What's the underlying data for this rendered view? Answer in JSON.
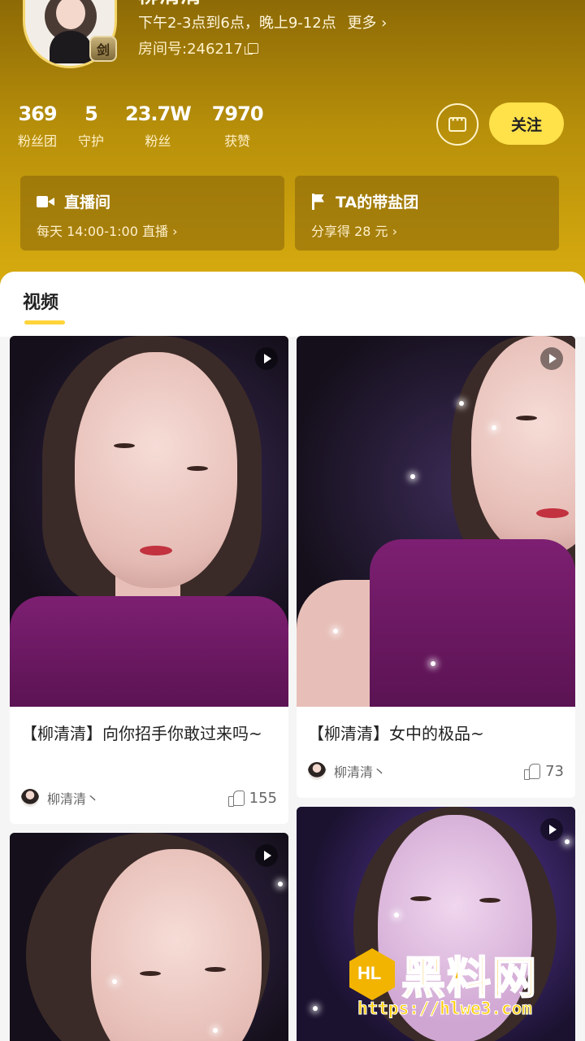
{
  "profile": {
    "name": "柳清清",
    "avatar_badge": "剑",
    "schedule": "下午2-3点到6点，晚上9-12点",
    "schedule_more": "更多 ›",
    "room_label": "房间号:246217"
  },
  "stats": [
    {
      "value": "369",
      "label": "粉丝团"
    },
    {
      "value": "5",
      "label": "守护"
    },
    {
      "value": "23.7W",
      "label": "粉丝"
    },
    {
      "value": "7970",
      "label": "获赞"
    }
  ],
  "actions": {
    "follow_label": "关注",
    "message_icon": "chat-bubble-icon"
  },
  "cards": {
    "live": {
      "title": "直播间",
      "subtitle": "每天 14:00-1:00 直播 ›",
      "icon": "video-camera-icon"
    },
    "team": {
      "title": "TA的带盐团",
      "subtitle": "分享得 28 元 ›",
      "icon": "flag-icon"
    }
  },
  "tabs": {
    "active": "视频"
  },
  "videos": [
    {
      "title": "【柳清清】向你招手你敢过来吗~",
      "author": "柳清清丶",
      "likes": "155"
    },
    {
      "title": "【柳清清】女中的极品~",
      "author": "柳清清丶",
      "likes": "73"
    }
  ],
  "watermark": {
    "logo_text": "HL",
    "name": "黑料网",
    "url": "https://hlwe3.com"
  },
  "colors": {
    "header_gold": "#b8900a",
    "follow_yellow": "#ffe14a",
    "tab_underline": "#ffd43a",
    "dress_purple": "#7d1f72"
  }
}
